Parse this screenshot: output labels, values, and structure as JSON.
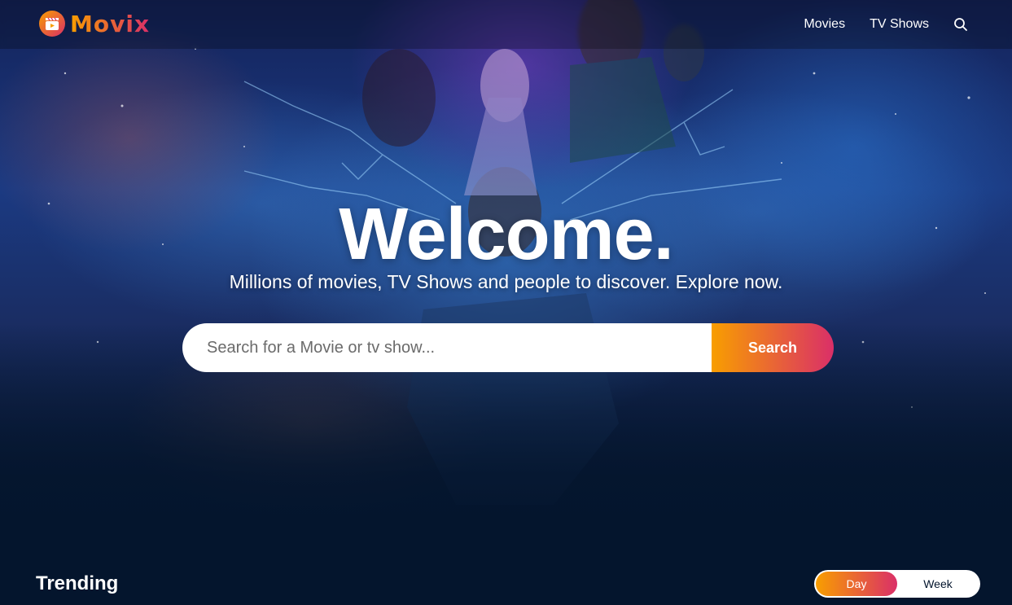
{
  "brand": {
    "name": "Movix",
    "colors": {
      "gradient_start": "#f89e00",
      "gradient_end": "#da2f68",
      "background": "#04152d"
    }
  },
  "header": {
    "nav": [
      {
        "label": "Movies"
      },
      {
        "label": "TV Shows"
      }
    ],
    "search_icon": "search-icon"
  },
  "hero": {
    "title": "Welcome.",
    "subtitle": "Millions of movies, TV Shows and people to discover. Explore now.",
    "search": {
      "placeholder": "Search for a Movie or tv show...",
      "value": "",
      "button_label": "Search"
    }
  },
  "trending": {
    "title": "Trending",
    "tabs": [
      {
        "label": "Day",
        "active": true
      },
      {
        "label": "Week",
        "active": false
      }
    ]
  }
}
